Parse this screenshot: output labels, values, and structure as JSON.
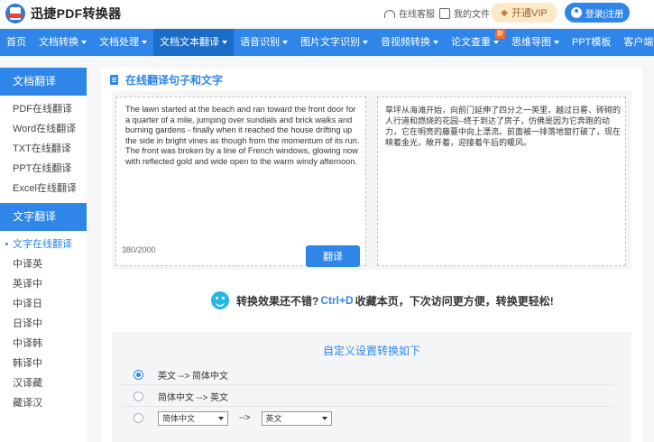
{
  "header": {
    "brand": "迅捷PDF转换器",
    "service_link": "在线客服",
    "docs_link": "我的文件",
    "vip_button": "开通VIP",
    "login_button": "登录|注册"
  },
  "nav": {
    "items": [
      {
        "label": "首页",
        "caret": false,
        "active": false
      },
      {
        "label": "文档转换",
        "caret": true,
        "active": false
      },
      {
        "label": "文档处理",
        "caret": true,
        "active": false
      },
      {
        "label": "文档文本翻译",
        "caret": true,
        "active": true
      },
      {
        "label": "语音识别",
        "caret": true,
        "active": false
      },
      {
        "label": "图片文字识别",
        "caret": true,
        "active": false
      },
      {
        "label": "音视频转换",
        "caret": true,
        "active": false
      },
      {
        "label": "论文查重",
        "caret": true,
        "active": false,
        "badge": "新"
      },
      {
        "label": "思维导图",
        "caret": true,
        "active": false
      },
      {
        "label": "PPT模板",
        "caret": false,
        "active": false
      },
      {
        "label": "客户端",
        "caret": true,
        "active": false
      }
    ]
  },
  "sidebar": {
    "doc_section": "文档翻译",
    "doc_items": [
      "PDF在线翻译",
      "Word在线翻译",
      "TXT在线翻译",
      "PPT在线翻译",
      "Excel在线翻译"
    ],
    "text_section": "文字翻译",
    "text_items": [
      "文字在线翻译",
      "中译英",
      "英译中",
      "中译日",
      "日译中",
      "中译韩",
      "韩译中",
      "汉译藏",
      "藏译汉"
    ],
    "active_item": "文字在线翻译"
  },
  "main": {
    "section_title": "在线翻译句子和文字",
    "source_text": "The lawn started at the beach and ran toward the front door for a quarter of a mile, jumping over sundials and brick walks and burning gardens - finally when it reached the house drifting up the side in bright vines as though from the momentum of its run. The front was broken by a line of French windows, glowing now with reflected gold and wide open to the warm windy afternoon.",
    "char_count": "380/2000",
    "translate_button": "翻译",
    "result_text": "草坪从海滩开始，向前门延伸了四分之一英里，越过日晷、砖砌的人行道和燃烧的花园--终于到达了房子，仿佛是因为它奔跑的动力，它在明亮的藤蔓中向上漂流。前面被一排落地窗打破了，现在映着金光，敞开着，迎接着午后的暖风。",
    "promo_prefix": "转换效果还不错?",
    "promo_highlight": "Ctrl+D",
    "promo_suffix": "收藏本页，下次访问更方便，转换更轻松!",
    "custom_title": "自定义设置转换如下",
    "options": [
      {
        "text": "英文 --> 简体中文",
        "selected": true
      },
      {
        "text": "简体中文 --> 英文",
        "selected": false
      }
    ],
    "custom_option": {
      "from": "简体中文",
      "arrow": "-->",
      "to": "英文"
    }
  }
}
